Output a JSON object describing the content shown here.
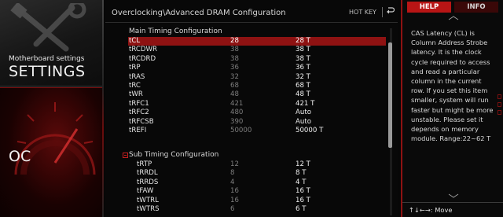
{
  "sidebar": {
    "settings_subtitle": "Motherboard settings",
    "settings_title": "SETTINGS",
    "oc_title": "OC"
  },
  "header": {
    "breadcrumb": "Overclocking\\Advanced DRAM Configuration",
    "hotkey": "HOT KEY",
    "back_icon": "back-arrow-icon"
  },
  "main_timing": {
    "title": "Main Timing Configuration",
    "rows": [
      {
        "name": "tCL",
        "current": "28",
        "value": "28 T",
        "selected": true
      },
      {
        "name": "tRCDWR",
        "current": "38",
        "value": "38 T"
      },
      {
        "name": "tRCDRD",
        "current": "38",
        "value": "38 T"
      },
      {
        "name": "tRP",
        "current": "36",
        "value": "36 T"
      },
      {
        "name": "tRAS",
        "current": "32",
        "value": "32 T"
      },
      {
        "name": "tRC",
        "current": "68",
        "value": "68 T"
      },
      {
        "name": "tWR",
        "current": "48",
        "value": "48 T"
      },
      {
        "name": "tRFC1",
        "current": "421",
        "value": "421 T"
      },
      {
        "name": "tRFC2",
        "current": "480",
        "value": "Auto"
      },
      {
        "name": "tRFCSB",
        "current": "390",
        "value": "Auto"
      },
      {
        "name": "tREFI",
        "current": "50000",
        "value": "50000 T"
      }
    ]
  },
  "sub_timing": {
    "title": "Sub Timing Configuration",
    "rows": [
      {
        "name": "tRTP",
        "current": "12",
        "value": "12 T"
      },
      {
        "name": "tRRDL",
        "current": "8",
        "value": "8 T"
      },
      {
        "name": "tRRDS",
        "current": "4",
        "value": "4 T"
      },
      {
        "name": "tFAW",
        "current": "16",
        "value": "16 T"
      },
      {
        "name": "tWTRL",
        "current": "16",
        "value": "16 T"
      },
      {
        "name": "tWTRS",
        "current": "6",
        "value": "6 T"
      }
    ]
  },
  "help_panel": {
    "tab_help": "HELP",
    "tab_info": "INFO",
    "text": "CAS Latency (CL) is Column Address Strobe latency. It is the clock cycle required to access and read a particular column in the current row. If you set this item smaller, system will run faster but might be more unstable. Please set it depends on memory module. Range:22~62 T",
    "footer": "↑↓←→: Move"
  },
  "colors": {
    "accent_red": "#8e1212",
    "tab_red": "#b81515",
    "background": "#080808"
  }
}
